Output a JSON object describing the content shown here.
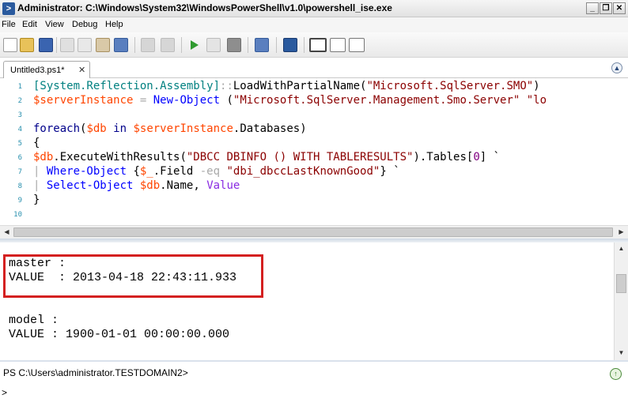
{
  "window": {
    "title": "Administrator: C:\\Windows\\System32\\WindowsPowerShell\\v1.0\\powershell_ise.exe",
    "minimize_glyph": "_",
    "restore_glyph": "❐",
    "close_glyph": "✕"
  },
  "menu": [
    "File",
    "Edit",
    "View",
    "Debug",
    "Help"
  ],
  "toolbar": {
    "icons": [
      "new-file-icon",
      "open-icon",
      "save-icon",
      "cut-icon",
      "copy-icon",
      "paste-icon",
      "clear-icon",
      "undo-icon",
      "redo-icon",
      "run-icon",
      "run-selection-icon",
      "stop-icon",
      "remote-icon",
      "powershell-icon",
      "layout-top-icon",
      "layout-right-icon",
      "layout-max-icon"
    ]
  },
  "tab": {
    "label": "Untitled3.ps1*",
    "close_glyph": "✕",
    "collapse_glyph": "▲"
  },
  "editor": {
    "line_numbers": [
      "1",
      "2",
      "3",
      "4",
      "5",
      "6",
      "7",
      "8",
      "9",
      "10"
    ],
    "lines": [
      [
        {
          "t": "[System.Reflection.Assembly]",
          "c": "c-type"
        },
        {
          "t": "::",
          "c": "c-op"
        },
        {
          "t": "LoadWithPartialName(",
          "c": "c-member"
        },
        {
          "t": "\"Microsoft.SqlServer.SMO\"",
          "c": "c-str"
        },
        {
          "t": ")",
          "c": "c-plain"
        }
      ],
      [
        {
          "t": "$serverInstance",
          "c": "c-var"
        },
        {
          "t": " = ",
          "c": "c-op"
        },
        {
          "t": "New-Object",
          "c": "c-cmd"
        },
        {
          "t": " (",
          "c": "c-plain"
        },
        {
          "t": "\"Microsoft.SqlServer.Management.Smo.Server\"",
          "c": "c-str"
        },
        {
          "t": " \"lo",
          "c": "c-str"
        }
      ],
      [],
      [
        {
          "t": "foreach",
          "c": "c-kw"
        },
        {
          "t": "(",
          "c": "c-plain"
        },
        {
          "t": "$db",
          "c": "c-var"
        },
        {
          "t": " in ",
          "c": "c-kw"
        },
        {
          "t": "$serverInstance",
          "c": "c-var"
        },
        {
          "t": ".Databases)",
          "c": "c-plain"
        }
      ],
      [
        {
          "t": "{",
          "c": "c-plain"
        }
      ],
      [
        {
          "t": "$db",
          "c": "c-var"
        },
        {
          "t": ".ExecuteWithResults(",
          "c": "c-plain"
        },
        {
          "t": "\"DBCC DBINFO () WITH TABLERESULTS\"",
          "c": "c-str"
        },
        {
          "t": ").Tables[",
          "c": "c-plain"
        },
        {
          "t": "0",
          "c": "c-num"
        },
        {
          "t": "] `",
          "c": "c-plain"
        }
      ],
      [
        {
          "t": "| ",
          "c": "c-op"
        },
        {
          "t": "Where-Object",
          "c": "c-cmd"
        },
        {
          "t": " {",
          "c": "c-plain"
        },
        {
          "t": "$_",
          "c": "c-var"
        },
        {
          "t": ".Field ",
          "c": "c-plain"
        },
        {
          "t": "-eq",
          "c": "c-op"
        },
        {
          "t": " ",
          "c": "c-plain"
        },
        {
          "t": "\"dbi_dbccLastKnownGood\"",
          "c": "c-str"
        },
        {
          "t": "} `",
          "c": "c-plain"
        }
      ],
      [
        {
          "t": "| ",
          "c": "c-op"
        },
        {
          "t": "Select-Object",
          "c": "c-cmd"
        },
        {
          "t": " ",
          "c": "c-plain"
        },
        {
          "t": "$db",
          "c": "c-var"
        },
        {
          "t": ".Name, ",
          "c": "c-plain"
        },
        {
          "t": "Value",
          "c": "c-attr"
        }
      ],
      [
        {
          "t": "}",
          "c": "c-plain"
        }
      ],
      []
    ]
  },
  "output": {
    "lines": [
      "master :",
      "VALUE  : 2013-04-18 22:43:11.933",
      "",
      "",
      "model :",
      "VALUE : 1900-01-01 00:00:00.000"
    ]
  },
  "command_pane": {
    "prompt": "PS C:\\Users\\administrator.TESTDOMAIN2>",
    "input": ">",
    "run_glyph": "↑"
  },
  "colors": {
    "highlight_box": "#d42020",
    "string": "#8b0000",
    "variable": "#ff4500",
    "command": "#0000ff",
    "type": "#008080"
  }
}
